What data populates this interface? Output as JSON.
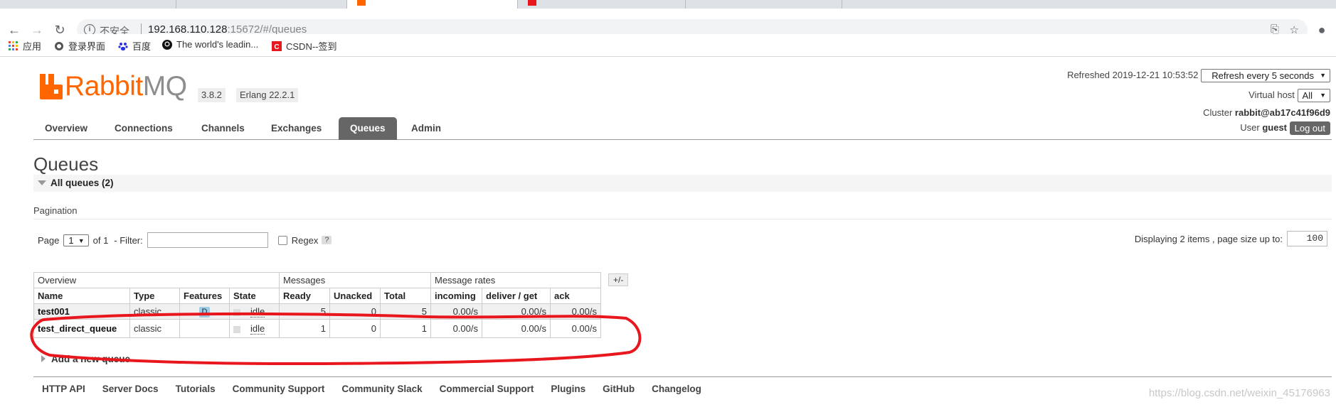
{
  "browser": {
    "insecure_label": "不安全",
    "url_host": "192.168.110.128",
    "url_rest": ":15672/#/queues",
    "bookmarks": [
      {
        "label": "应用",
        "icon": "apps-grid-icon"
      },
      {
        "label": "登录界面",
        "icon": "globe-icon"
      },
      {
        "label": "百度",
        "icon": "baidu-paw-icon"
      },
      {
        "label": "The world's leadin...",
        "icon": "github-icon"
      },
      {
        "label": "CSDN--签到",
        "icon": "csdn-icon"
      }
    ]
  },
  "app": {
    "logo_rabbit": "Rabbit",
    "logo_mq": "MQ",
    "version": "3.8.2",
    "erlang": "Erlang 22.2.1",
    "refreshed_label": "Refreshed 2019-12-21 10:53:52",
    "refresh_select": "Refresh every 5 seconds",
    "vhost_label": "Virtual host",
    "vhost_value": "All",
    "cluster_label": "Cluster",
    "cluster_value": "rabbit@ab17c41f96d9",
    "user_label": "User",
    "user_value": "guest",
    "logout_label": "Log out"
  },
  "nav": {
    "overview": "Overview",
    "connections": "Connections",
    "channels": "Channels",
    "exchanges": "Exchanges",
    "queues": "Queues",
    "admin": "Admin"
  },
  "page": {
    "title": "Queues",
    "section_label": "All queues (2)",
    "pagination_title": "Pagination",
    "page_label": "Page",
    "page_value": "1",
    "of_label": "of 1",
    "filter_label": "- Filter:",
    "regex_label": "Regex",
    "help_label": "?",
    "display_label": "Displaying 2 items , page size up to:",
    "page_size": "100",
    "plusminus": "+/-",
    "add_queue": "Add a new queue"
  },
  "table": {
    "groups": {
      "overview": "Overview",
      "messages": "Messages",
      "rates": "Message rates"
    },
    "headers": [
      "Name",
      "Type",
      "Features",
      "State",
      "Ready",
      "Unacked",
      "Total",
      "incoming",
      "deliver / get",
      "ack"
    ],
    "rows": [
      {
        "name": "test001",
        "type": "classic",
        "feature": "D",
        "state": "idle",
        "ready": "5",
        "unacked": "0",
        "total": "5",
        "incoming": "0.00/s",
        "deliver": "0.00/s",
        "ack": "0.00/s"
      },
      {
        "name": "test_direct_queue",
        "type": "classic",
        "feature": "",
        "state": "idle",
        "ready": "1",
        "unacked": "0",
        "total": "1",
        "incoming": "0.00/s",
        "deliver": "0.00/s",
        "ack": "0.00/s"
      }
    ]
  },
  "footer": {
    "links": [
      "HTTP API",
      "Server Docs",
      "Tutorials",
      "Community Support",
      "Community Slack",
      "Commercial Support",
      "Plugins",
      "GitHub",
      "Changelog"
    ]
  },
  "watermark": "https://blog.csdn.net/weixin_45176963",
  "colors": {
    "brand": "#ff6600",
    "annotation": "#e8171d"
  }
}
